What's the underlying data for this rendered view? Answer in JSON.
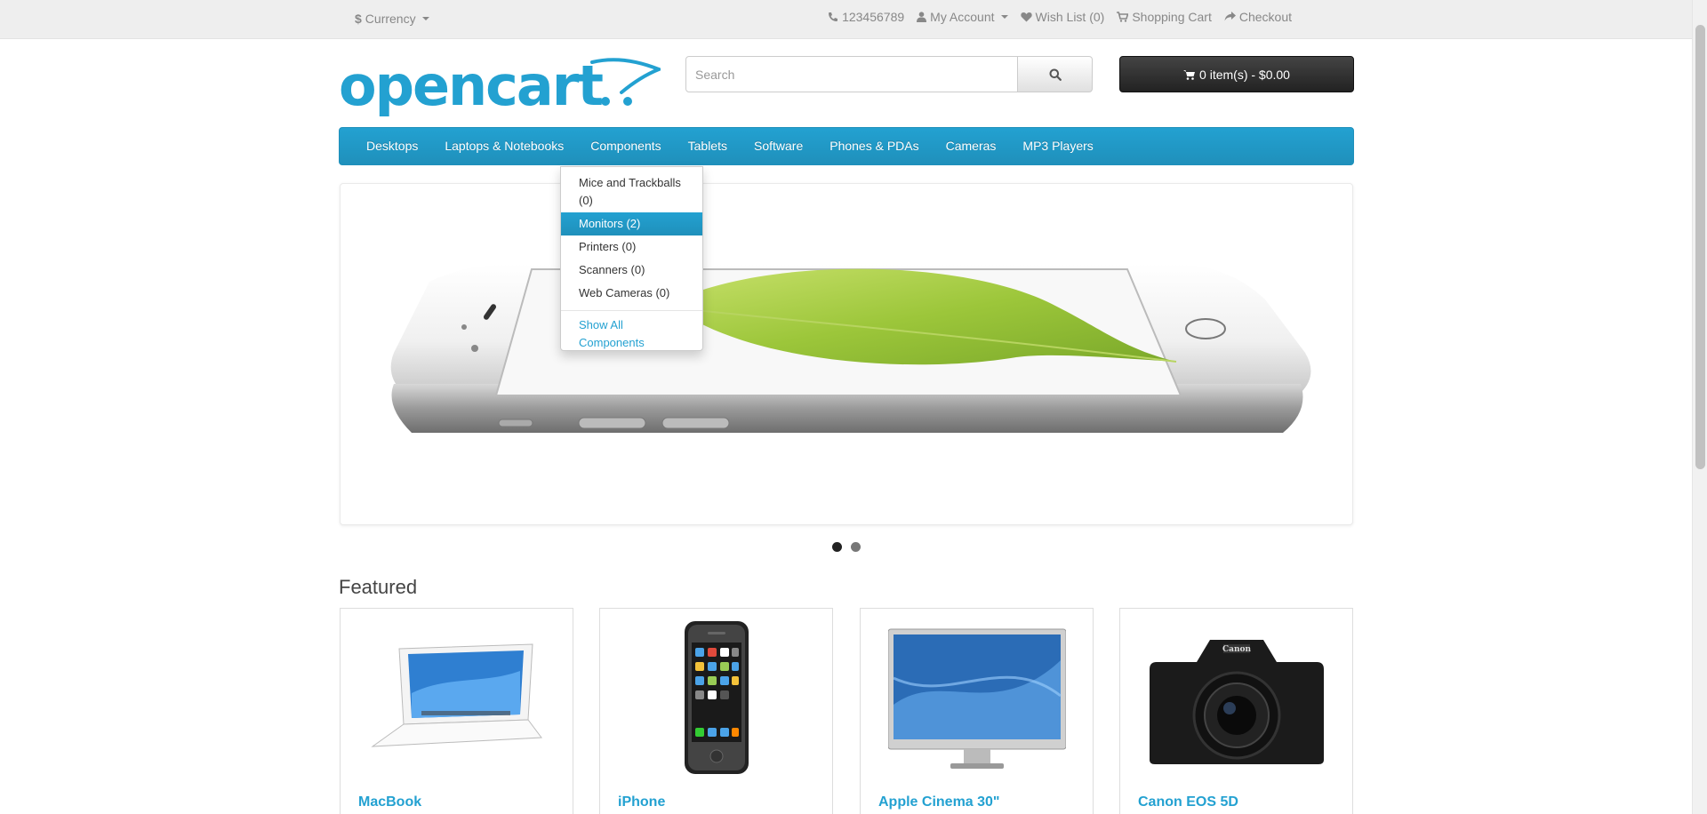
{
  "topbar": {
    "currency_symbol": "$",
    "currency_label": "Currency",
    "phone": "123456789",
    "my_account": "My Account",
    "wishlist": "Wish List (0)",
    "shopping_cart": "Shopping Cart",
    "checkout": "Checkout"
  },
  "header": {
    "logo_text": "opencart",
    "search_placeholder": "Search",
    "cart_label": "0 item(s) - $0.00"
  },
  "menu": {
    "items": [
      "Desktops",
      "Laptops & Notebooks",
      "Components",
      "Tablets",
      "Software",
      "Phones & PDAs",
      "Cameras",
      "MP3 Players"
    ]
  },
  "dropdown": {
    "items": [
      {
        "label": "Mice and Trackballs (0)",
        "active": false
      },
      {
        "label": "Monitors (2)",
        "active": true
      },
      {
        "label": "Printers (0)",
        "active": false
      },
      {
        "label": "Scanners (0)",
        "active": false
      },
      {
        "label": "Web Cameras (0)",
        "active": false
      }
    ],
    "show_all": "Show All Components"
  },
  "featured": {
    "title": "Featured",
    "products": [
      {
        "name": "MacBook"
      },
      {
        "name": "iPhone"
      },
      {
        "name": "Apple Cinema 30\""
      },
      {
        "name": "Canon EOS 5D"
      }
    ]
  },
  "colors": {
    "brand_blue": "#23a1d1",
    "cart_dark": "#303030",
    "topbar_bg": "#eeeeee"
  }
}
